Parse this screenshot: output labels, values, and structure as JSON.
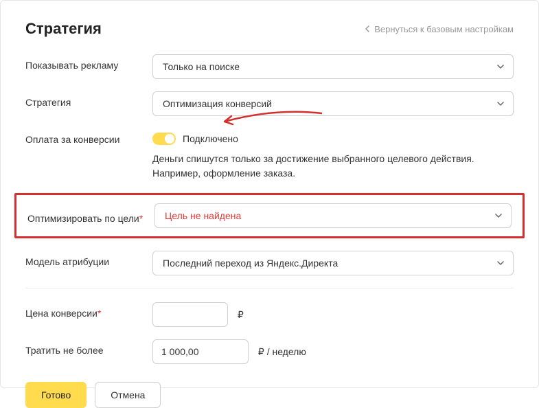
{
  "header": {
    "title": "Стратегия",
    "back": "Вернуться к базовым настройкам"
  },
  "show_ads": {
    "label": "Показывать рекламу",
    "value": "Только на поиске"
  },
  "strategy": {
    "label": "Стратегия",
    "value": "Оптимизация конверсий"
  },
  "pay_conv": {
    "label": "Оплата за конверсии",
    "toggle_label": "Подключено",
    "hint1": "Деньги спишутся только за достижение выбранного целевого действия.",
    "hint2": "Например, оформление заказа."
  },
  "optimize": {
    "label": "Оптимизировать по цели",
    "value": "Цель не найдена"
  },
  "attribution": {
    "label": "Модель атрибуции",
    "value": "Последний переход из Яндекс.Директа"
  },
  "price": {
    "label": "Цена конверсии",
    "value": "",
    "suffix": "₽"
  },
  "budget": {
    "label": "Тратить не более",
    "value": "1 000,00",
    "suffix": "₽ / неделю"
  },
  "footer": {
    "done": "Готово",
    "cancel": "Отмена"
  }
}
